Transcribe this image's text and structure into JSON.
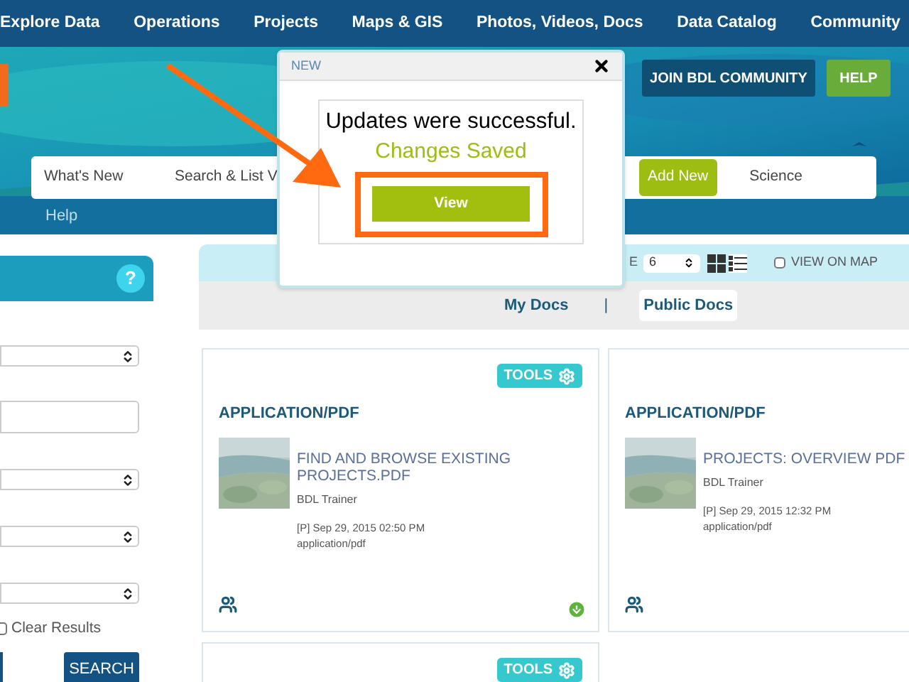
{
  "nav": {
    "items": [
      "Explore Data",
      "Operations",
      "Projects",
      "Maps & GIS",
      "Photos, Videos, Docs",
      "Data Catalog",
      "Community"
    ]
  },
  "header": {
    "buttons": [
      {
        "label": "JOIN BDL COMMUNITY",
        "kind": "dark"
      },
      {
        "label": "HELP",
        "kind": "green"
      }
    ],
    "subnav": [
      {
        "label": "What's New",
        "selected": false
      },
      {
        "label": "Search & List V",
        "selected": false
      },
      {
        "label": "Add New",
        "selected": true
      },
      {
        "label": "Science",
        "selected": false
      }
    ],
    "help_link": "Help"
  },
  "sidebar": {
    "help_icon": "?",
    "fields": [
      {
        "kind": "select"
      },
      {
        "kind": "input"
      },
      {
        "kind": "select"
      },
      {
        "kind": "select"
      },
      {
        "kind": "select"
      }
    ],
    "clear_results": {
      "label": "Clear Results",
      "checked": false
    },
    "search_button": "SEARCH"
  },
  "toolbar": {
    "page_size_label": "E",
    "page_size": "6",
    "view_on_map": {
      "label": "VIEW ON MAP",
      "checked": false
    }
  },
  "doc_tabs": [
    {
      "label": "My Docs",
      "selected": false
    },
    {
      "label": "Public Docs",
      "selected": true
    }
  ],
  "doc_tabs_separator": "|",
  "cards": [
    {
      "tools": "TOOLS",
      "type": "APPLICATION/PDF",
      "title": "FIND AND BROWSE EXISTING PROJECTS.PDF",
      "author": "BDL Trainer",
      "date": "[P] Sep 29, 2015 02:50 PM",
      "mime": "application/pdf",
      "download": true
    },
    {
      "type": "APPLICATION/PDF",
      "title": "PROJECTS: OVERVIEW PDF",
      "author": "BDL Trainer",
      "date": "[P] Sep 29, 2015 12:32 PM",
      "mime": "application/pdf",
      "download": false
    },
    {
      "tools": "TOOLS"
    }
  ],
  "modal": {
    "title": "NEW",
    "message": "Updates were successful.",
    "status": "Changes Saved",
    "button": "View"
  }
}
